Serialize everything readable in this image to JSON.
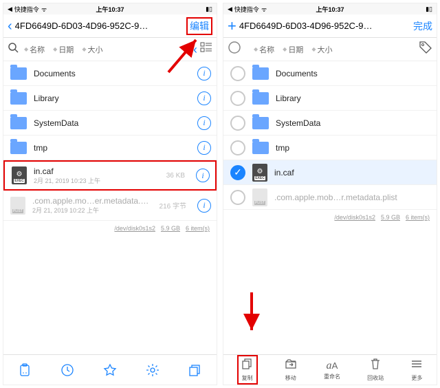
{
  "statusbar": {
    "back_app": "快捷指令",
    "time": "上午10:37",
    "battery_pct": 100
  },
  "nav": {
    "title_truncated": "4FD6649D-6D03-4D96-952C-9…",
    "edit_label": "编辑",
    "done_label": "完成"
  },
  "sort": {
    "name": "名称",
    "date": "日期",
    "size": "大小"
  },
  "folders": [
    {
      "name": "Documents"
    },
    {
      "name": "Library"
    },
    {
      "name": "SystemData"
    },
    {
      "name": "tmp"
    }
  ],
  "files": [
    {
      "name": "in.caf",
      "size": "36 KB",
      "meta": "2月 21, 2019 10:23 上午"
    },
    {
      "name": ".com.apple.mo…er.metadata.plist",
      "size": "216 字节",
      "meta": "2月 21, 2019 10:22 上午"
    }
  ],
  "files_right": [
    {
      "name": "in.caf"
    },
    {
      "name": ".com.apple.mob…r.metadata.plist"
    }
  ],
  "footer_info": {
    "device": "/dev/disk0s1s2",
    "space": "5.9 GB",
    "count": "6 item(s)"
  },
  "action_bar": {
    "copy": "复制",
    "move": "移动",
    "rename": "重命名",
    "trash": "回收站",
    "more": "更多"
  }
}
